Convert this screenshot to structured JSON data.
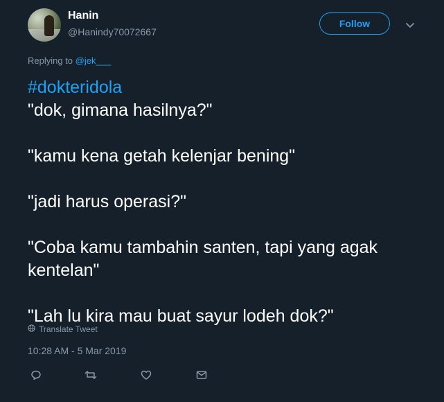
{
  "author": {
    "name": "Hanin",
    "handle": "@Hanindy70072667"
  },
  "follow_button": {
    "label": "Follow"
  },
  "reply_context": {
    "prefix": "Replying to",
    "mention": "@jek___"
  },
  "tweet": {
    "hashtag": "#dokteridola",
    "lines": [
      "\"dok, gimana hasilnya?\"",
      "\"kamu kena getah kelenjar bening\"",
      "\"jadi harus operasi?\"",
      "\"Coba kamu tambahin santen, tapi yang agak",
      "kentelan\"",
      "\"Lah lu kira mau buat sayur lodeh dok?\""
    ]
  },
  "translate": {
    "label": "Translate Tweet",
    "icon": "globe-icon"
  },
  "timestamp": "10:28 AM - 5 Mar 2019",
  "actions": [
    {
      "name": "reply",
      "icon": "comment-icon"
    },
    {
      "name": "retweet",
      "icon": "retweet-icon"
    },
    {
      "name": "like",
      "icon": "heart-icon"
    },
    {
      "name": "message",
      "icon": "envelope-icon"
    }
  ],
  "colors": {
    "background": "#15202b",
    "accent": "#1da1f2",
    "secondary_text": "#8899a6",
    "text": "#ffffff"
  }
}
